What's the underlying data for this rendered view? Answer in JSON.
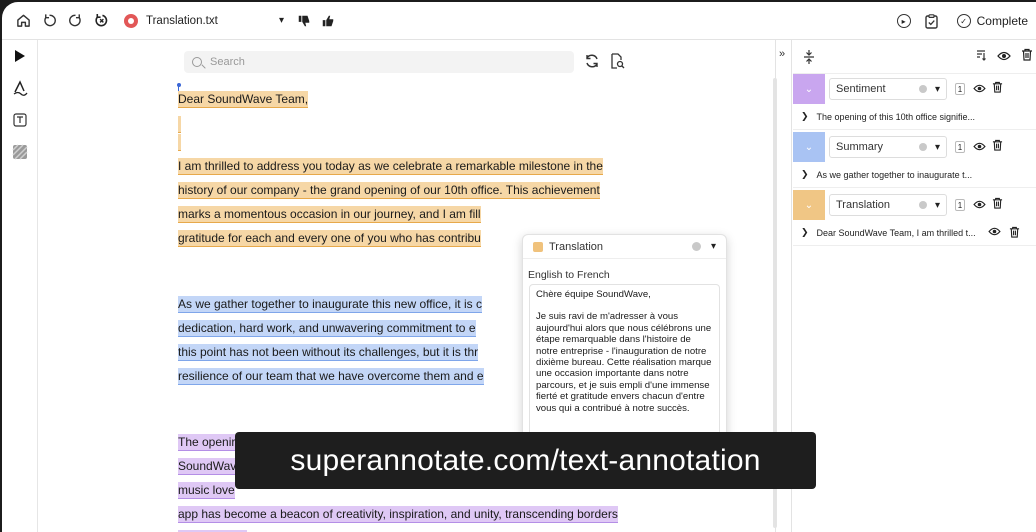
{
  "topbar": {
    "file_name": "Translation.txt",
    "complete_label": "Complete"
  },
  "editor": {
    "search_placeholder": "Search",
    "lines": [
      {
        "text": "Dear SoundWave Team,",
        "hl": "o"
      },
      {
        "text": "",
        "hl": "o"
      },
      {
        "text": "",
        "hl": "o"
      },
      {
        "text": "I am thrilled to address you today as we celebrate a remarkable milestone in the",
        "hl": "o"
      },
      {
        "text": "history of our company - the grand opening of our 10th office. This achievement",
        "hl": "o"
      },
      {
        "text": "marks a momentous occasion in our journey, and I am fill",
        "hl": "o"
      },
      {
        "text": "gratitude for each and every one of you who has contribu",
        "hl": "o"
      },
      {
        "text": "As we gather together to inaugurate this new office, it is c",
        "hl": "b"
      },
      {
        "text": "dedication, hard work, and unwavering commitment to e",
        "hl": "b"
      },
      {
        "text": "this point has not been without its challenges, but it is thr",
        "hl": "b"
      },
      {
        "text": "resilience of our team that we have overcome them and e",
        "hl": "b"
      },
      {
        "text": "The openir",
        "hl": "p"
      },
      {
        "text": "SoundWav",
        "hl": "p"
      },
      {
        "text": "music love",
        "hl": "p"
      },
      {
        "text": "app has become a beacon of creativity, inspiration, and unity, transcending borders",
        "hl": "p"
      },
      {
        "text": "and cultures.",
        "hl": "p"
      }
    ]
  },
  "popover": {
    "class_label": "Translation",
    "subtitle": "English to French",
    "paragraph1": "Chère équipe SoundWave,",
    "paragraph2": "Je suis ravi de m'adresser à vous aujourd'hui alors que nous célébrons une étape remarquable dans l'histoire de notre entreprise - l'inauguration de notre dixième bureau. Cette réalisation marque une occasion importante dans notre parcours, et je suis empli d'une immense fierté et gratitude envers chacun d'entre vous qui a contribué à notre succès."
  },
  "panel": {
    "classes": [
      {
        "label": "Sentiment",
        "count": "1",
        "preview": "The opening of this 10th office signifie...",
        "color": "#c9a6ef"
      },
      {
        "label": "Summary",
        "count": "1",
        "preview": "As we gather together to inaugurate t...",
        "color": "#a9c3f3"
      },
      {
        "label": "Translation",
        "count": "1",
        "preview": "Dear SoundWave Team, I am thrilled t...",
        "color": "#f0c685"
      }
    ]
  },
  "watermark": "superannotate.com/text-annotation"
}
